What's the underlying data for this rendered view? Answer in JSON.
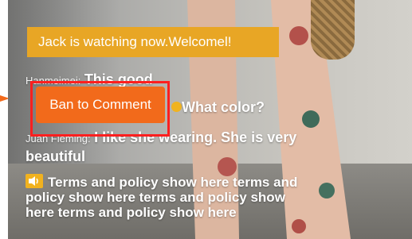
{
  "banner": {
    "text": "Jack is watching now.Welcomel!"
  },
  "chat": [
    {
      "user": "Hanmeimei:",
      "message": "This good"
    },
    {
      "user": "",
      "message": "What color?"
    },
    {
      "user": "Juan Fleming:",
      "message": "I like she wearing. She is very beautiful"
    }
  ],
  "terms": {
    "text": "Terms and policy show here terms and policy show here terms and policy show here terms and policy show here"
  },
  "ban_button": {
    "label": "Ban to Comment"
  },
  "colors": {
    "banner": "#e8a625",
    "ban_button": "#f26a1b",
    "highlight": "#ff1f1f",
    "arrow": "#f26a1b"
  }
}
